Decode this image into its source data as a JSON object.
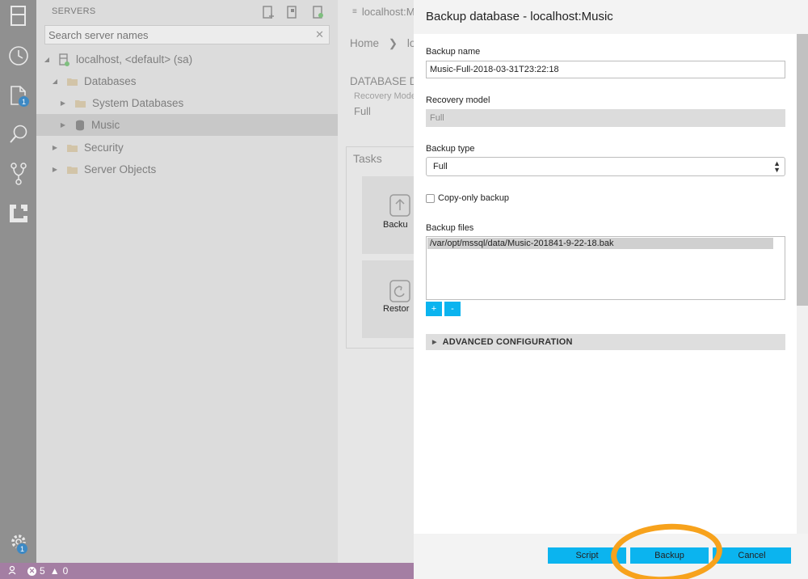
{
  "activity_bar": {
    "icons": [
      "servers-icon",
      "history-icon",
      "explorer-icon",
      "search-icon",
      "source-control-icon",
      "extensions-icon",
      "settings-icon"
    ],
    "explorer_badge": "1",
    "settings_badge": "1"
  },
  "sidebar": {
    "title": "SERVERS",
    "search_placeholder": "Search server names",
    "tree": [
      {
        "label": "localhost, <default> (sa)"
      },
      {
        "label": "Databases"
      },
      {
        "label": "System Databases"
      },
      {
        "label": "Music"
      },
      {
        "label": "Security"
      },
      {
        "label": "Server Objects"
      }
    ]
  },
  "editor": {
    "tab_label": "localhost:M",
    "breadcrumb_home": "Home",
    "breadcrumb_next": "loca",
    "section_title": "DATABASE D",
    "recovery_label": "Recovery Mode",
    "recovery_value": "Full",
    "tasks_title": "Tasks",
    "task_backup": "Backu",
    "task_restore": "Restor"
  },
  "status_bar": {
    "errors": "5",
    "warnings": "0"
  },
  "dialog": {
    "title": "Backup database - localhost:Music",
    "backup_name_label": "Backup name",
    "backup_name_value": "Music-Full-2018-03-31T23:22:18",
    "recovery_model_label": "Recovery model",
    "recovery_model_value": "Full",
    "backup_type_label": "Backup type",
    "backup_type_value": "Full",
    "copy_only_label": "Copy-only backup",
    "copy_only_checked": false,
    "backup_files_label": "Backup files",
    "backup_files": [
      "/var/opt/mssql/data/Music-201841-9-22-18.bak"
    ],
    "add_label": "+",
    "remove_label": "-",
    "advanced_label": "ADVANCED CONFIGURATION",
    "script_button": "Script",
    "backup_button": "Backup",
    "cancel_button": "Cancel"
  },
  "colors": {
    "accent": "#0bb4ef",
    "status_bar": "#a47ea3",
    "highlight": "#f7a21c",
    "activity_bar": "#909090"
  }
}
